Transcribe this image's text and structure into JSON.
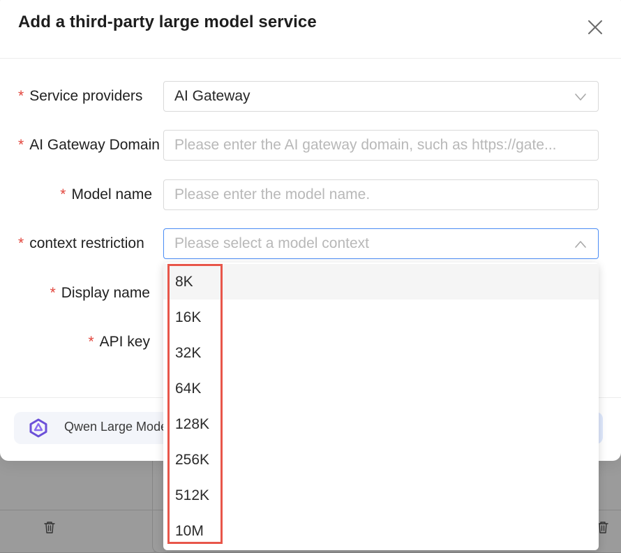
{
  "modal": {
    "title": "Add a third-party large model service"
  },
  "form": {
    "service_provider": {
      "label": "Service providers",
      "value": "AI Gateway"
    },
    "gateway_domain": {
      "label": "AI Gateway Domain",
      "placeholder": "Please enter the AI gateway domain, such as https://gate..."
    },
    "model_name": {
      "label": "Model name",
      "placeholder": "Please enter the model name."
    },
    "context_restriction": {
      "label": "context restriction",
      "placeholder": "Please select a model context"
    },
    "display_name": {
      "label": "Display name"
    },
    "api_key": {
      "label": "API key"
    },
    "required_mark": "*"
  },
  "dropdown": {
    "options": [
      "8K",
      "16K",
      "32K",
      "64K",
      "128K",
      "256K",
      "512K",
      "10M"
    ],
    "active_index": 0
  },
  "footer": {
    "provider_card_label": "Qwen Large Model"
  },
  "colors": {
    "required": "#e2453c",
    "focus_border": "#4a8cf5",
    "highlight_box": "#e8564a",
    "overlay": "#8e8e8e"
  },
  "icons": [
    "close-icon",
    "chevron-down-icon",
    "chevron-up-icon",
    "qwen-logo-icon",
    "trash-icon"
  ]
}
